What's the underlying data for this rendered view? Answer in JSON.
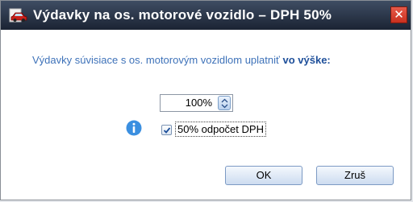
{
  "dialog": {
    "title": "Výdavky na os. motorové vozidlo – DPH 50%",
    "close_label": "✕",
    "icon": "car-icon"
  },
  "prompt": {
    "text": "Výdavky súvisiace s os. motorovým vozidlom uplatniť ",
    "emphasis": "vo výške:"
  },
  "spinner": {
    "value": "100%"
  },
  "option": {
    "checked": true,
    "label": "50% odpočet DPH",
    "info_icon": "info-icon"
  },
  "buttons": {
    "ok_label": "OK",
    "cancel_label": "Zruš"
  },
  "colors": {
    "titlebar": "#2b3547",
    "close": "#d63e2d",
    "prompt_text": "#3e72b9",
    "info": "#3b8fe0"
  }
}
